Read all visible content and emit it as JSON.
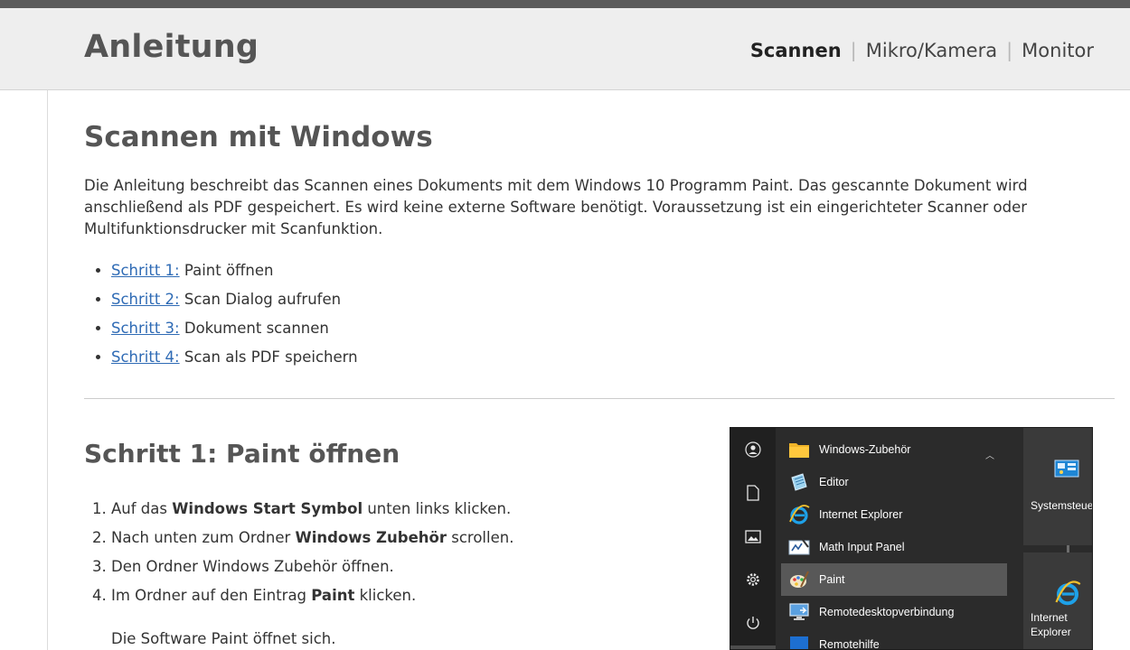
{
  "header": {
    "title": "Anleitung",
    "nav": [
      {
        "label": "Scannen",
        "active": true
      },
      {
        "label": "Mikro/Kamera",
        "active": false
      },
      {
        "label": "Monitor",
        "active": false
      }
    ],
    "separator": "|"
  },
  "page": {
    "heading": "Scannen mit Windows",
    "intro": "Die Anleitung beschreibt das Scannen eines Dokuments mit dem Windows 10 Programm Paint. Das gescannte Dokument wird anschließend als PDF gespeichert. Es wird keine externe Software benötigt. Voraussetzung ist ein eingerichteter Scanner oder Multifunktionsdrucker mit Scanfunktion.",
    "steps": [
      {
        "link": "Schritt 1:",
        "text": " Paint öffnen"
      },
      {
        "link": "Schritt 2:",
        "text": " Scan Dialog aufrufen"
      },
      {
        "link": "Schritt 3:",
        "text": " Dokument scannen"
      },
      {
        "link": "Schritt 4:",
        "text": " Scan als PDF speichern"
      }
    ]
  },
  "step1": {
    "heading": "Schritt 1: Paint öffnen",
    "instructions": [
      {
        "pre": "Auf das ",
        "bold": "Windows Start Symbol",
        "post": " unten links klicken."
      },
      {
        "pre": "Nach unten zum Ordner ",
        "bold": "Windows Zubehör",
        "post": " scrollen."
      },
      {
        "pre": "Den Ordner Windows Zubehör öffnen.",
        "bold": "",
        "post": ""
      },
      {
        "pre": "Im Ordner auf den Eintrag ",
        "bold": "Paint",
        "post": " klicken."
      }
    ],
    "result": "Die Software Paint öffnet sich."
  },
  "screenshot": {
    "folder": "Windows-Zubehör",
    "items": [
      "Editor",
      "Internet Explorer",
      "Math Input Panel",
      "Paint",
      "Remotedesktopverbindung",
      "Remotehilfe"
    ],
    "highlighted": "Paint",
    "tiles": [
      {
        "label_lines": [
          "Systemsteuer"
        ]
      },
      {
        "label_lines": [
          "Internet",
          "Explorer"
        ]
      }
    ],
    "rail_icons": [
      "user-icon",
      "document-icon",
      "pictures-icon",
      "settings-icon",
      "power-icon"
    ]
  },
  "colors": {
    "link": "#2f6bb5",
    "header_bg": "#eeeeee",
    "topbar": "#5c5c5c",
    "heading": "#555555",
    "highlight": "#585858"
  }
}
